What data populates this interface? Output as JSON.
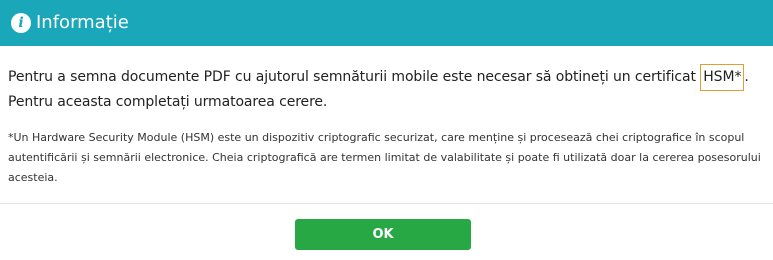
{
  "header": {
    "icon": "info-icon",
    "icon_glyph": "i",
    "title": "Informație",
    "background_color": "#1aa7b9"
  },
  "body": {
    "main_text_before": "Pentru a semna documente PDF cu ajutorul semnăturii mobile este necesar să obtineți un certificat ",
    "highlight": "HSM*",
    "main_text_after": ". Pentru aceasta completați urmatoarea cerere.",
    "note": "*Un Hardware Security Module (HSM) este un dispozitiv criptografic securizat, care menține și procesează chei criptografice în scopul autentificării și semnării electronice. Cheia criptografică are termen limitat de valabilitate și poate fi utilizată doar la cererea posesorului acesteia."
  },
  "footer": {
    "ok_label": "OK",
    "ok_color": "#28a745"
  }
}
